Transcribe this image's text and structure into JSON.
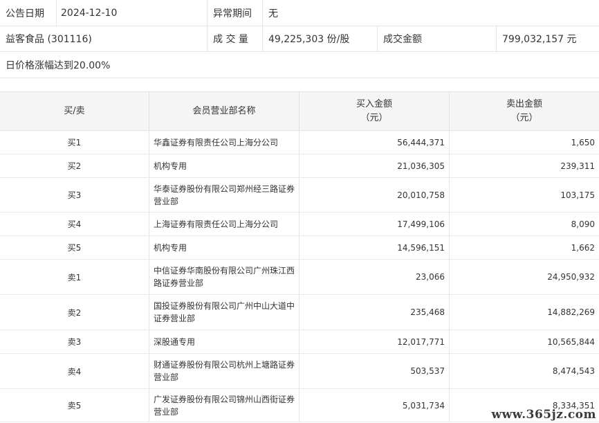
{
  "info": {
    "announce_label": "公告日期",
    "announce_date": "2024-12-10",
    "abnormal_label": "异常期间",
    "abnormal_value": "无",
    "stock_name": "益客食品 (301116)",
    "volume_label": "成 交 量",
    "volume_value": "49,225,303 份/股",
    "amount_label": "成交金额",
    "amount_value": "799,032,157 元",
    "reason": "日价格涨幅达到20.00%"
  },
  "table": {
    "headers": {
      "side": "买/卖",
      "name": "会员营业部名称",
      "buy_line1": "买入金额",
      "buy_line2": "（元）",
      "sell_line1": "卖出金额",
      "sell_line2": "（元）"
    },
    "rows": [
      {
        "side": "买1",
        "name": "华鑫证券有限责任公司上海分公司",
        "buy": "56,444,371",
        "sell": "1,650"
      },
      {
        "side": "买2",
        "name": "机构专用",
        "buy": "21,036,305",
        "sell": "239,311"
      },
      {
        "side": "买3",
        "name": "华泰证券股份有限公司郑州经三路证券营业部",
        "buy": "20,010,758",
        "sell": "103,175"
      },
      {
        "side": "买4",
        "name": "上海证券有限责任公司上海分公司",
        "buy": "17,499,106",
        "sell": "8,090"
      },
      {
        "side": "买5",
        "name": "机构专用",
        "buy": "14,596,151",
        "sell": "1,662"
      },
      {
        "side": "卖1",
        "name": "中信证券华南股份有限公司广州珠江西路证券营业部",
        "buy": "23,066",
        "sell": "24,950,932"
      },
      {
        "side": "卖2",
        "name": "国投证券股份有限公司广州中山大道中证券营业部",
        "buy": "235,468",
        "sell": "14,882,269"
      },
      {
        "side": "卖3",
        "name": "深股通专用",
        "buy": "12,017,771",
        "sell": "10,565,844"
      },
      {
        "side": "卖4",
        "name": "财通证券股份有限公司杭州上塘路证券营业部",
        "buy": "503,537",
        "sell": "8,474,543"
      },
      {
        "side": "卖5",
        "name": "广发证券股份有限公司锦州山西街证券营业部",
        "buy": "5,031,734",
        "sell": "8,334,351"
      }
    ]
  },
  "watermark": "www.365jz.com"
}
